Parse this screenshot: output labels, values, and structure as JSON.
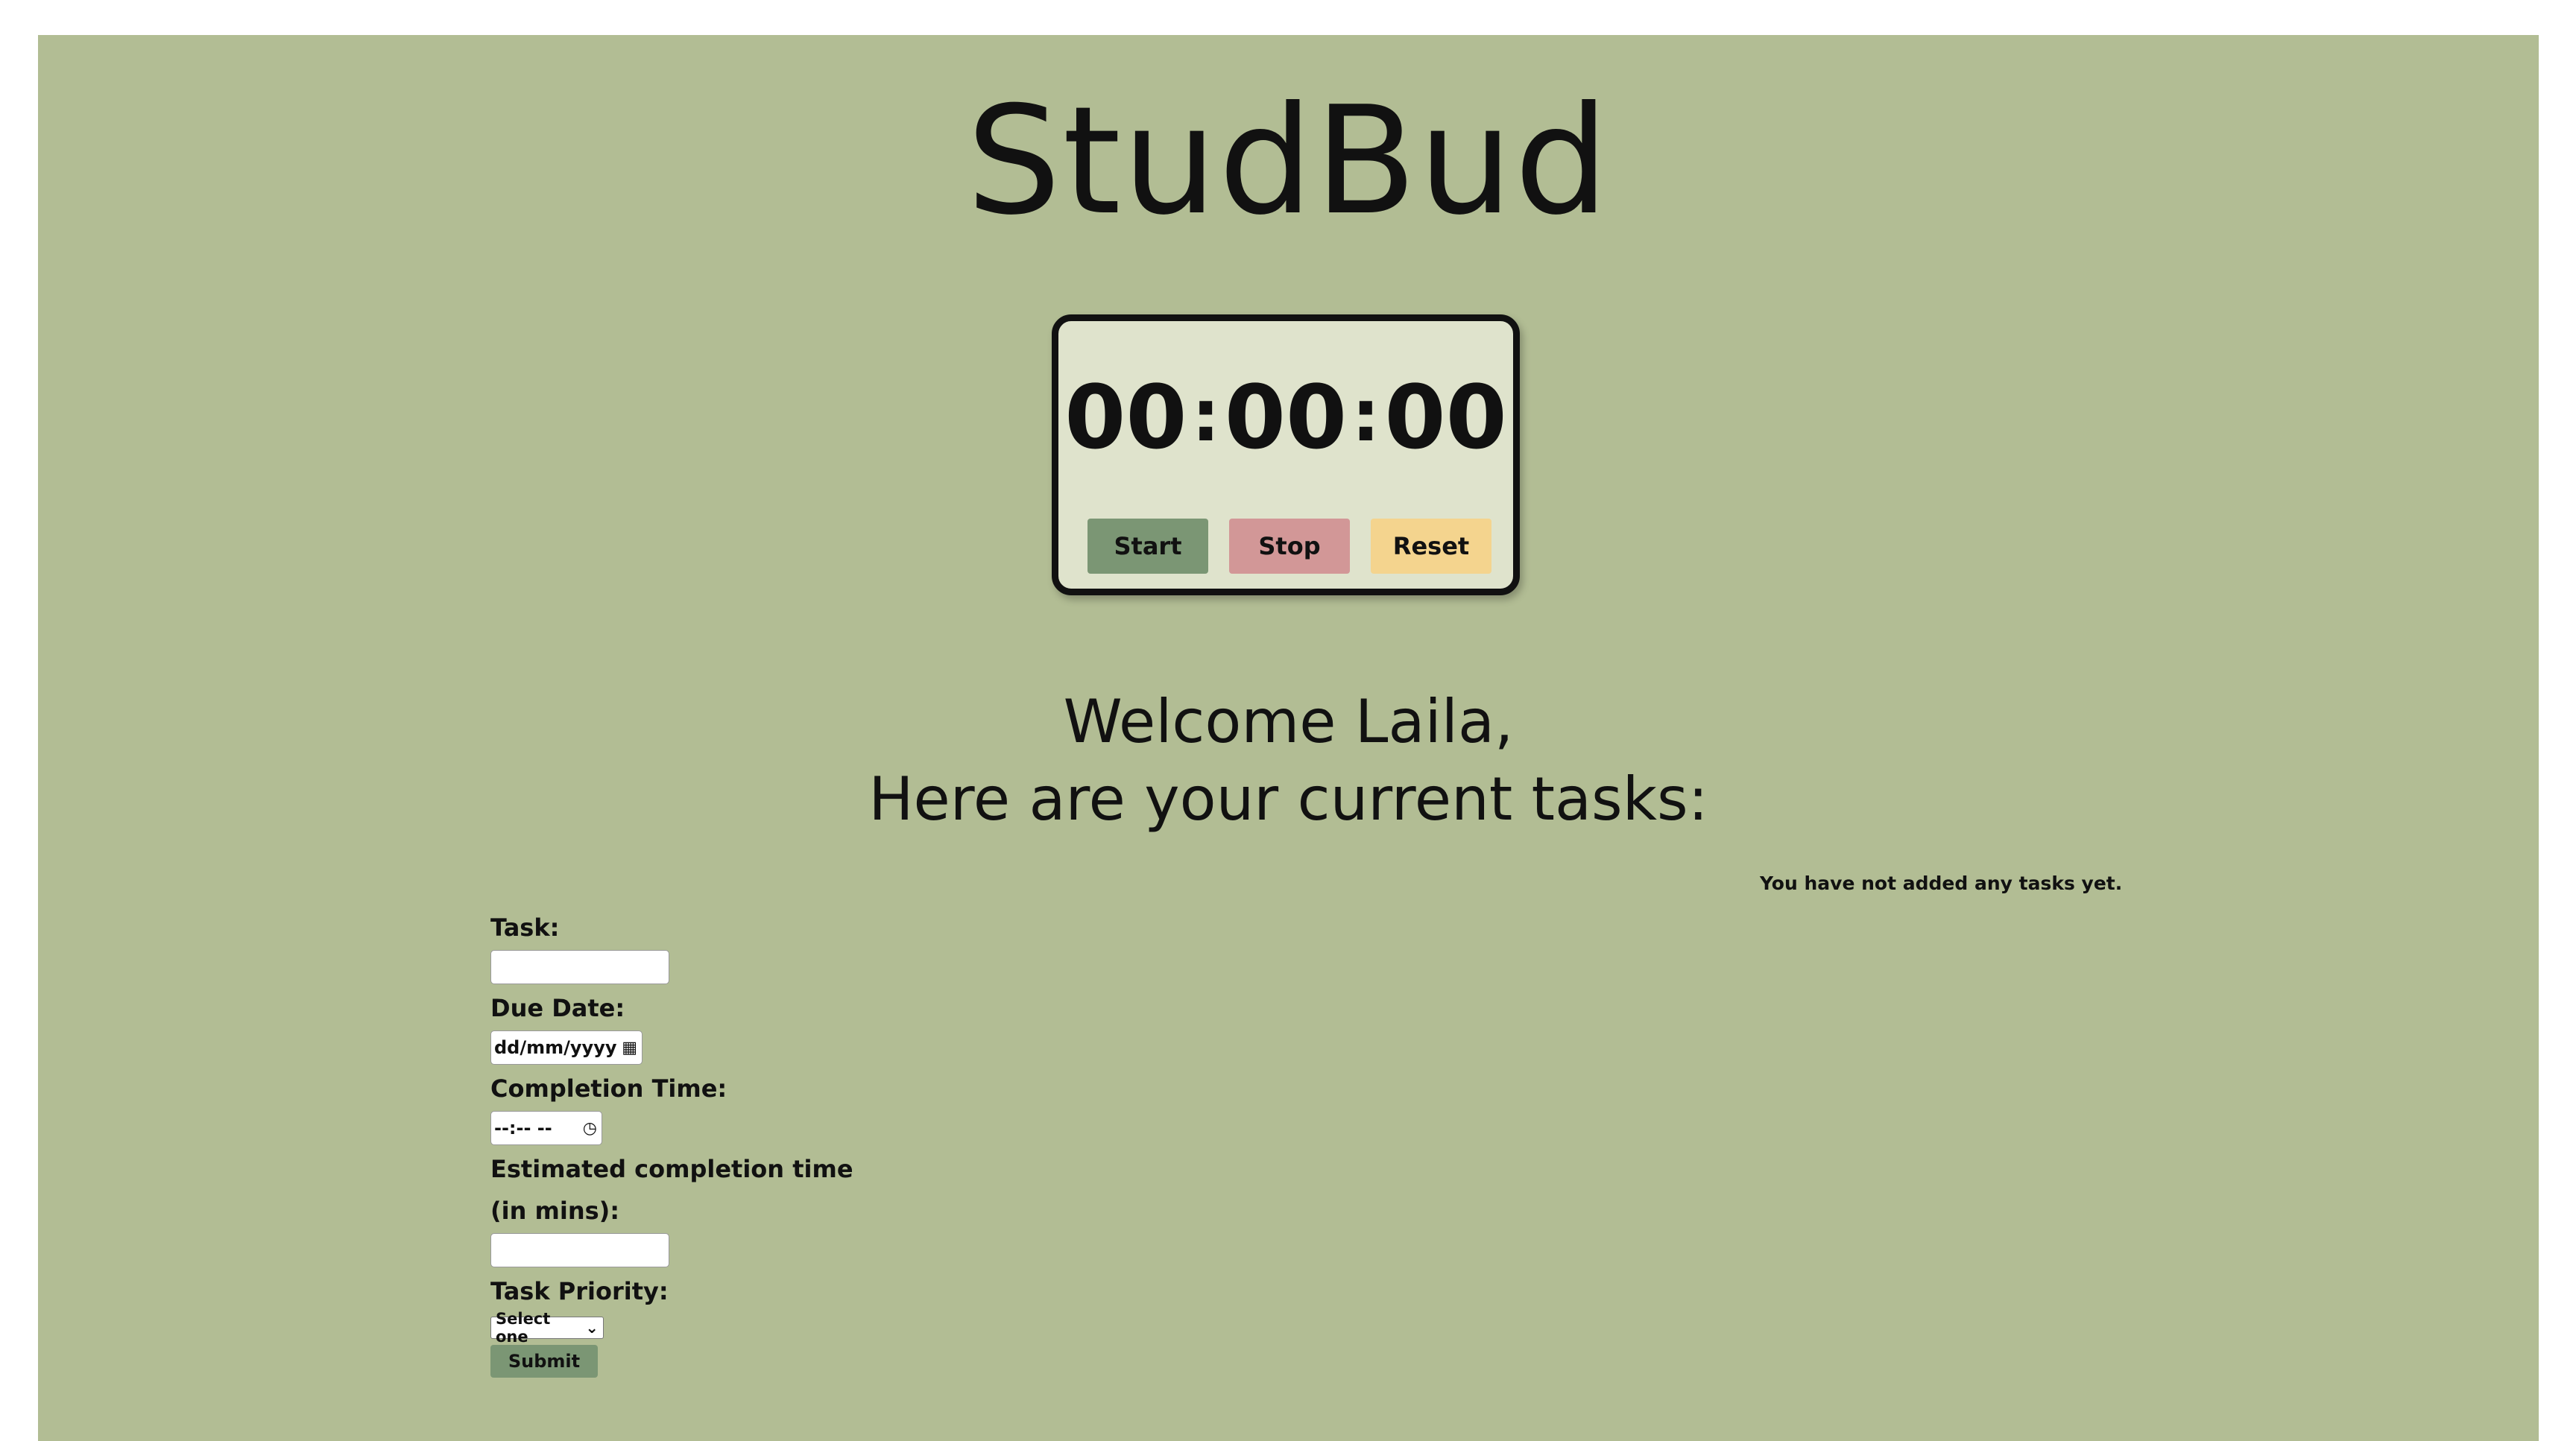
{
  "header": {
    "title": "StudBud"
  },
  "timer": {
    "hours": "00",
    "minutes": "00",
    "seconds": "00",
    "separator": ":",
    "start_label": "Start",
    "stop_label": "Stop",
    "reset_label": "Reset"
  },
  "welcome": {
    "line1": "Welcome Laila,",
    "line2": "Here are your current tasks:"
  },
  "tasks": {
    "empty_message": "You have not added any tasks yet."
  },
  "form": {
    "task_label": "Task:",
    "task_value": "",
    "due_date_label": "Due Date:",
    "due_date_placeholder": "dd/mm/yyyy",
    "completion_time_label": "Completion Time:",
    "completion_time_placeholder": "--:-- --",
    "estimate_label": "Estimated completion time (in mins):",
    "estimate_value": "",
    "priority_label": "Task Priority:",
    "priority_selected": "Select one",
    "submit_label": "Submit"
  },
  "colors": {
    "page_background": "#b2bd94",
    "timer_background": "#dfe3cc",
    "start_button": "#7b9674",
    "stop_button": "#d29797",
    "reset_button": "#f4d48e"
  },
  "icons": {
    "date_icon": "calendar-icon",
    "time_icon": "clock-icon",
    "select_icon": "chevron-down-icon"
  }
}
